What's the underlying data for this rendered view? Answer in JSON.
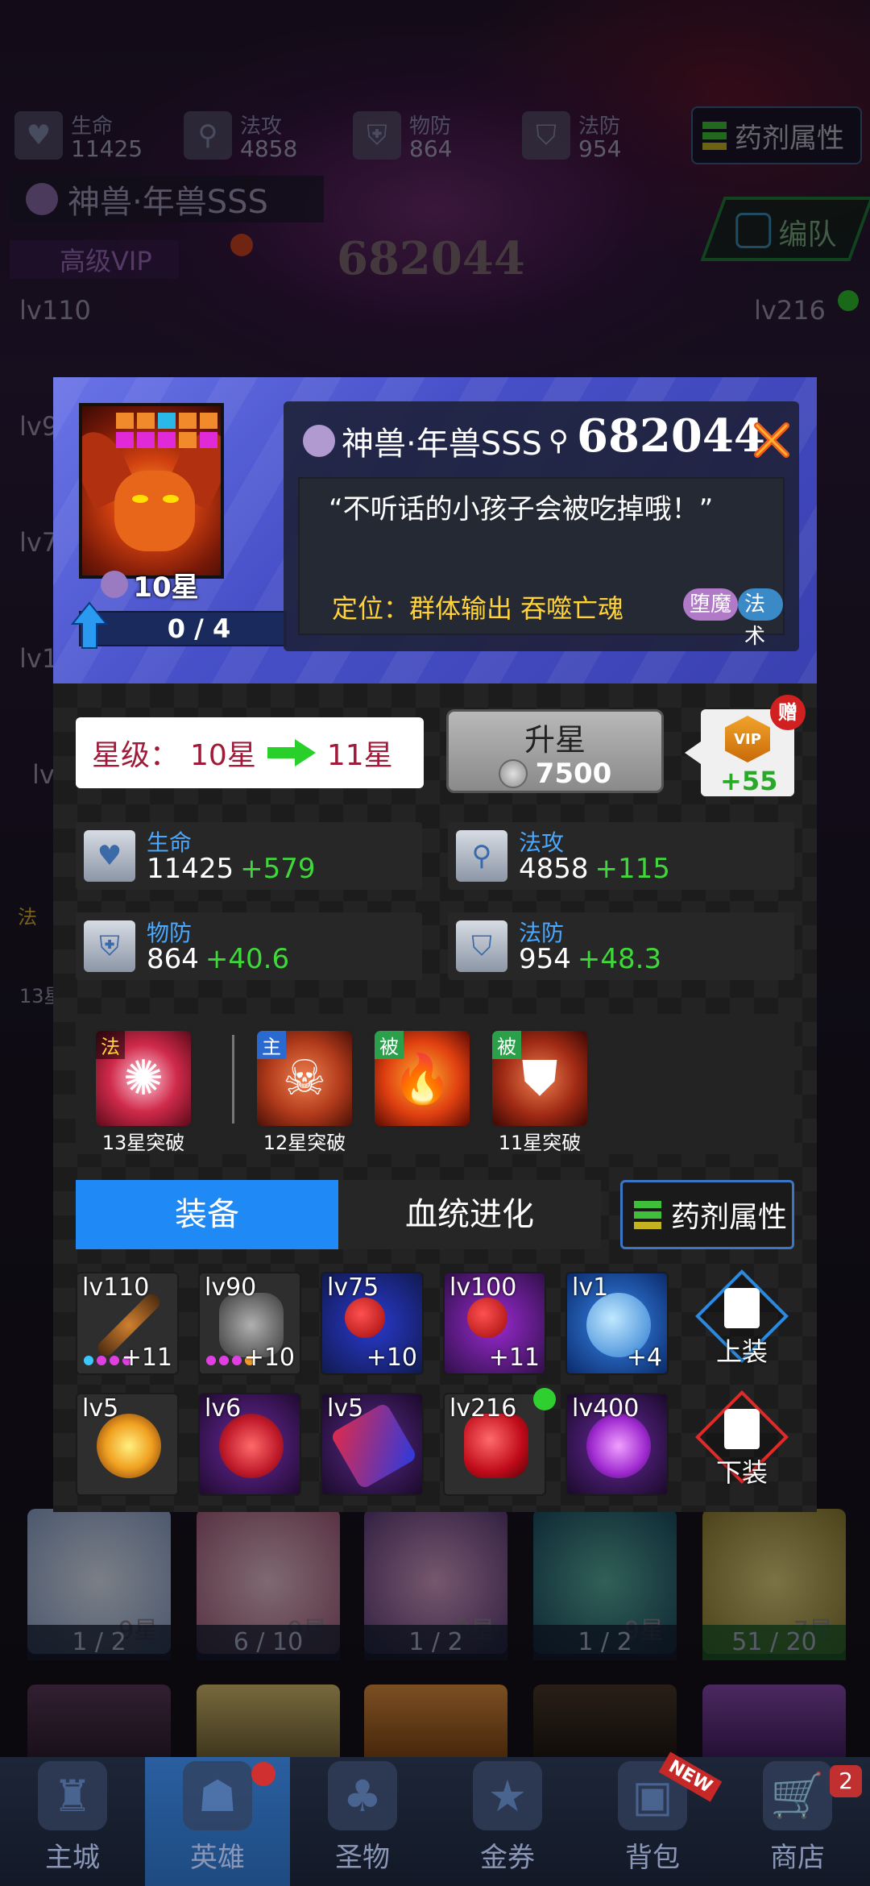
{
  "top_stats": [
    {
      "label": "生命",
      "value": "11425",
      "icon": "heart-shield-icon"
    },
    {
      "label": "法攻",
      "value": "4858",
      "icon": "magic-wand-icon"
    },
    {
      "label": "物防",
      "value": "864",
      "icon": "sword-shield-icon"
    },
    {
      "label": "法防",
      "value": "954",
      "icon": "magic-shield-icon"
    }
  ],
  "top_potion_label": "药剂属性",
  "top_hero_title": "神兽·年兽SSS",
  "top_vip_label": "高级VIP",
  "top_power": "682044",
  "team_button": "编队",
  "side_levels": {
    "left": [
      "lv110",
      "lv9",
      "lv7",
      "lv1",
      "lv"
    ],
    "right": "lv216",
    "left_small": [
      "法",
      "13星"
    ]
  },
  "modal": {
    "hero_name": "神兽·年兽SSS",
    "power": "682044",
    "portrait_star": "10星",
    "fragments": "0 / 4",
    "quote": "“不听话的小孩子会被吃掉哦！”",
    "role_label": "定位：群体输出 吞噬亡魂",
    "tags": [
      "堕魔",
      "法术"
    ],
    "star_level": {
      "label": "星级：",
      "current": "10星",
      "next": "11星"
    },
    "upstar": {
      "label": "升星",
      "cost": "7500"
    },
    "vip_bonus": {
      "badge": "VIP",
      "plus": "+55",
      "gift": "赠"
    },
    "attributes": [
      {
        "label": "生命",
        "value": "11425",
        "bonus": "+579",
        "icon": "heart-shield-icon"
      },
      {
        "label": "法攻",
        "value": "4858",
        "bonus": "+115",
        "icon": "magic-wand-icon"
      },
      {
        "label": "物防",
        "value": "864",
        "bonus": "+40.6",
        "icon": "sword-shield-icon"
      },
      {
        "label": "法防",
        "value": "954",
        "bonus": "+48.3",
        "icon": "magic-shield-icon"
      }
    ],
    "skills": [
      {
        "type": "法",
        "caption": "13星突破"
      },
      {
        "type": "主",
        "caption": "12星突破"
      },
      {
        "type": "被",
        "caption": ""
      },
      {
        "type": "被",
        "caption": "11星突破"
      }
    ],
    "tabs": {
      "equip": "装备",
      "bloodline": "血统进化"
    },
    "potion_button": "药剂属性",
    "equipment_row1": [
      {
        "level": "lv110",
        "enhance": "+11"
      },
      {
        "level": "lv90",
        "enhance": "+10"
      },
      {
        "level": "lv75",
        "enhance": "+10"
      },
      {
        "level": "lv100",
        "enhance": "+11"
      },
      {
        "level": "lv1",
        "enhance": "+4"
      }
    ],
    "equipment_row2": [
      {
        "level": "lv5",
        "enhance": ""
      },
      {
        "level": "lv6",
        "enhance": ""
      },
      {
        "level": "lv5",
        "enhance": ""
      },
      {
        "level": "lv216",
        "enhance": ""
      },
      {
        "level": "lv400",
        "enhance": ""
      }
    ],
    "equip_button": "上装",
    "unequip_button": "下装"
  },
  "roster": [
    {
      "star": "9星",
      "progress": "1 / 2"
    },
    {
      "star": "9星",
      "progress": "6 / 10"
    },
    {
      "star": "9星",
      "progress": "1 / 2"
    },
    {
      "star": "9星",
      "progress": "1 / 2"
    },
    {
      "star": "7星",
      "progress": "51 / 20"
    }
  ],
  "bottom_nav": [
    {
      "label": "主城",
      "icon": "castle-icon"
    },
    {
      "label": "英雄",
      "icon": "hero-helmet-icon"
    },
    {
      "label": "圣物",
      "icon": "clover-icon"
    },
    {
      "label": "金券",
      "icon": "ticket-icon"
    },
    {
      "label": "背包",
      "icon": "backpack-icon"
    },
    {
      "label": "商店",
      "icon": "cart-icon"
    }
  ],
  "nav_badges": {
    "shop_count": "2",
    "bag_new": "NEW"
  }
}
